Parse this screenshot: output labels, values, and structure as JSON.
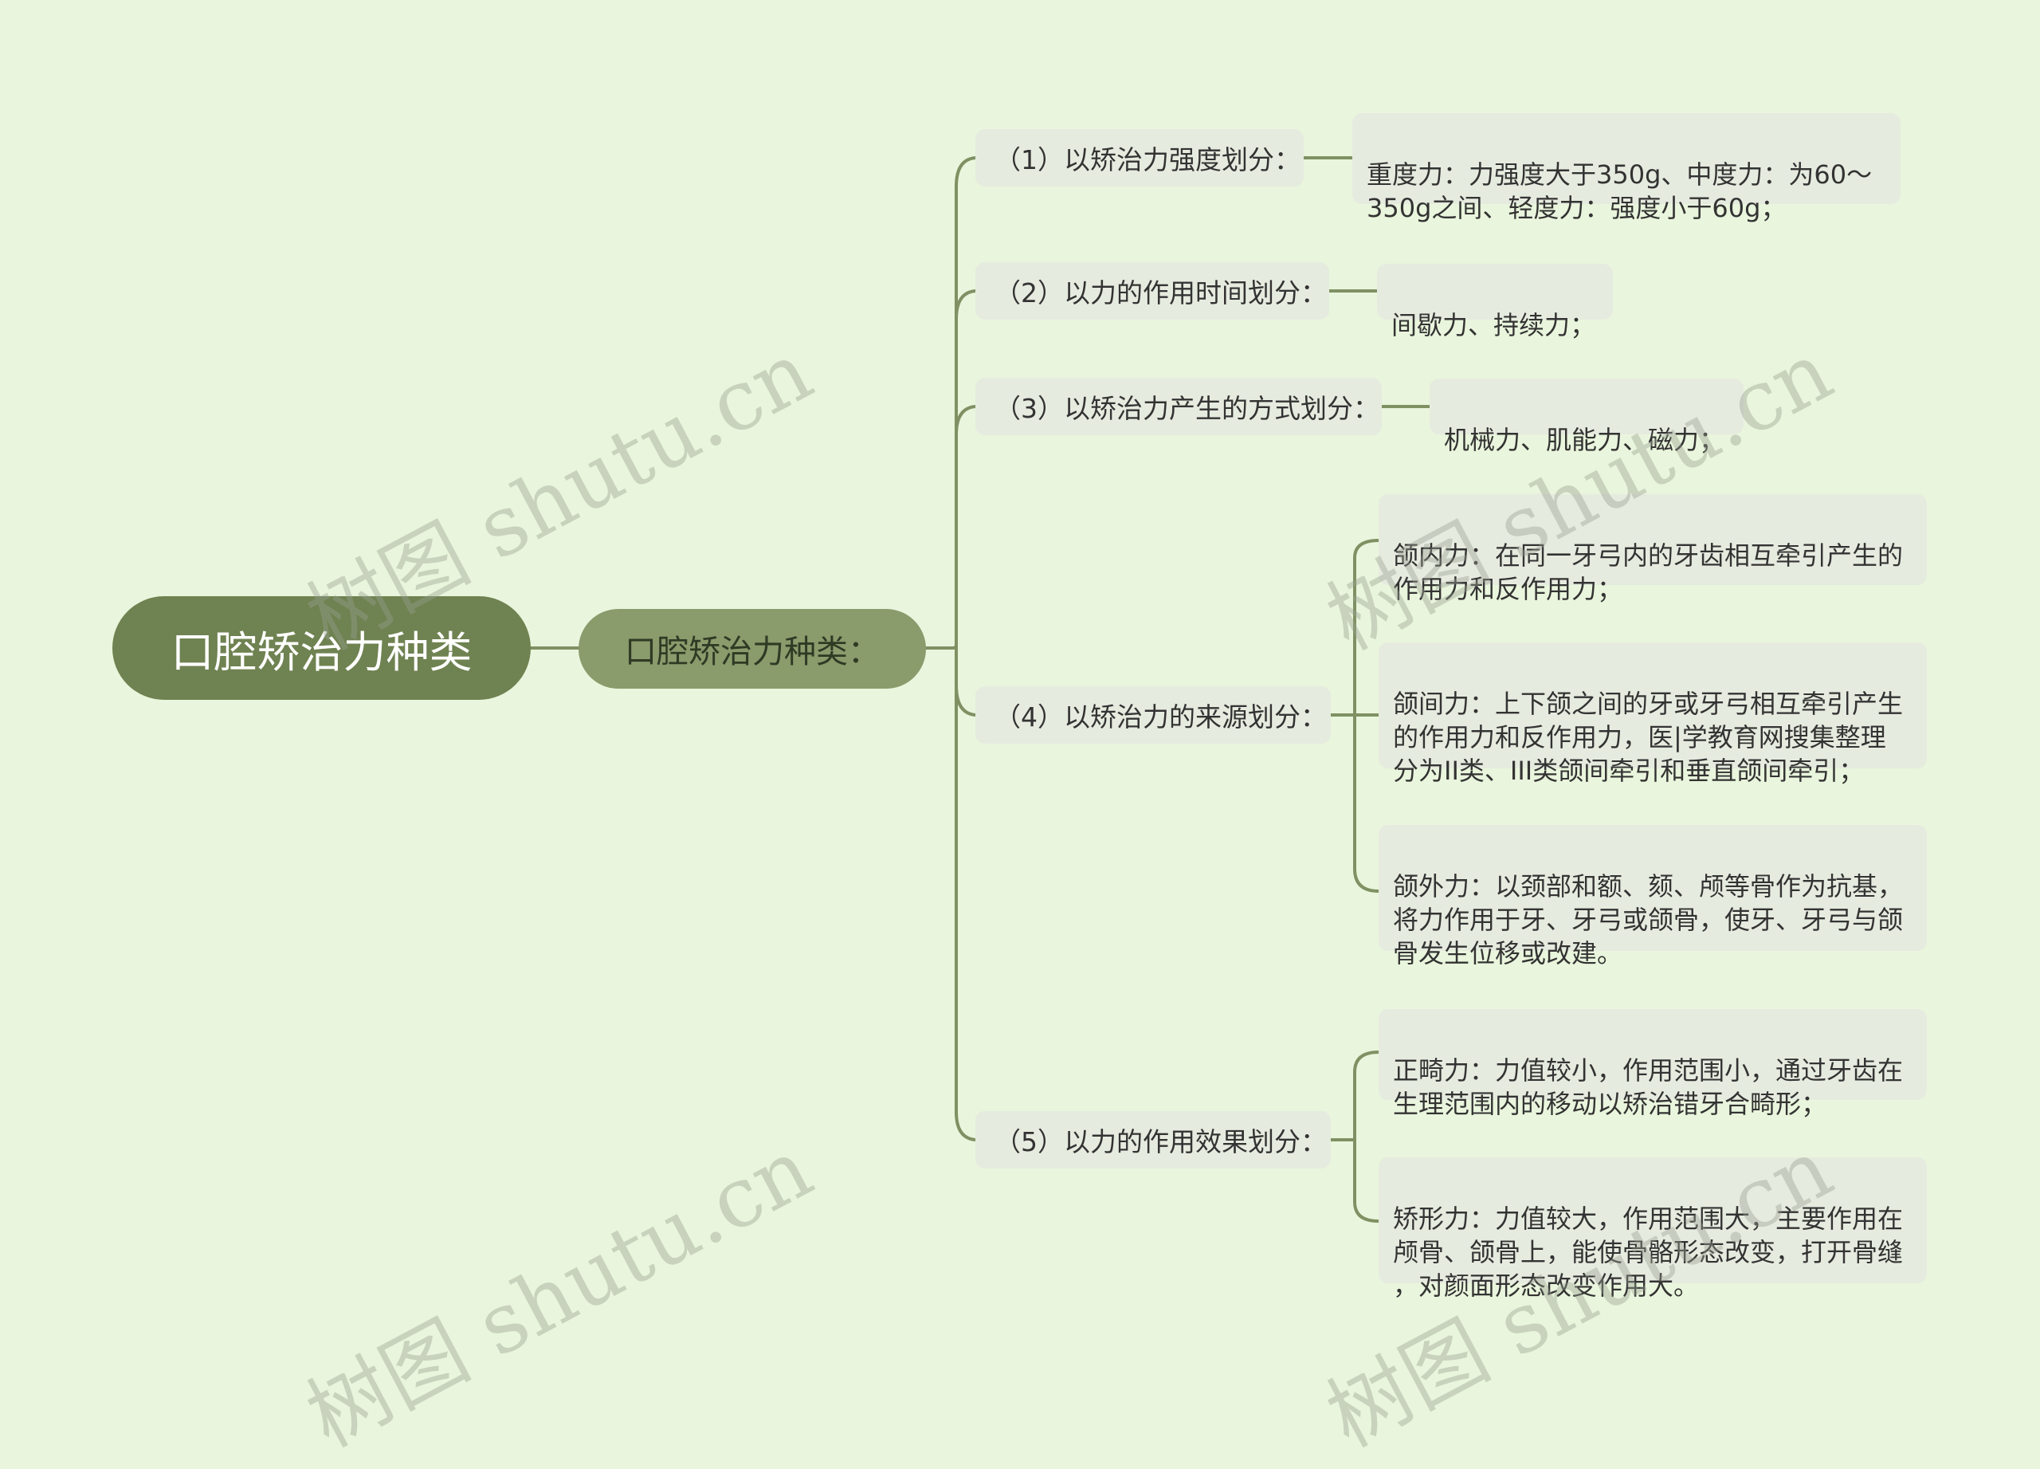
{
  "root": {
    "label": "口腔矫治力种类"
  },
  "sub": {
    "label": "口腔矫治力种类："
  },
  "categories": [
    {
      "label": "（1）以矫治力强度划分："
    },
    {
      "label": "（2）以力的作用时间划分："
    },
    {
      "label": "（3）以矫治力产生的方式划分："
    },
    {
      "label": "（4）以矫治力的来源划分："
    },
    {
      "label": "（5）以力的作用效果划分："
    }
  ],
  "leaves": [
    {
      "text": "重度力：力强度大于350g、中度力：为60～\n350g之间、轻度力：强度小于60g；"
    },
    {
      "text": "间歇力、持续力；"
    },
    {
      "text": "机械力、肌能力、磁力；"
    },
    {
      "text": "颌内力：在同一牙弓内的牙齿相互牵引产生的\n作用力和反作用力；"
    },
    {
      "text": "颌间力：上下颌之间的牙或牙弓相互牵引产生\n的作用力和反作用力，医|学教育网搜集整理\n分为II类、III类颌间牵引和垂直颌间牵引；"
    },
    {
      "text": "颌外力：以颈部和额、颏、颅等骨作为抗基，\n将力作用于牙、牙弓或颌骨，使牙、牙弓与颌\n骨发生位移或改建。"
    },
    {
      "text": "正畸力：力值较小，作用范围小，通过牙齿在\n生理范围内的移动以矫治错牙合畸形；"
    },
    {
      "text": "矫形力：力值较大，作用范围大，主要作用在\n颅骨、颌骨上，能使骨骼形态改变，打开骨缝\n，对颜面形态改变作用大。"
    }
  ],
  "watermark": "树图 shutu.cn",
  "colors": {
    "background": "#e9f5dc",
    "root": "#6f8251",
    "sub": "#8a9b6c",
    "node": "#e6ebdf",
    "line": "#7f9163"
  }
}
